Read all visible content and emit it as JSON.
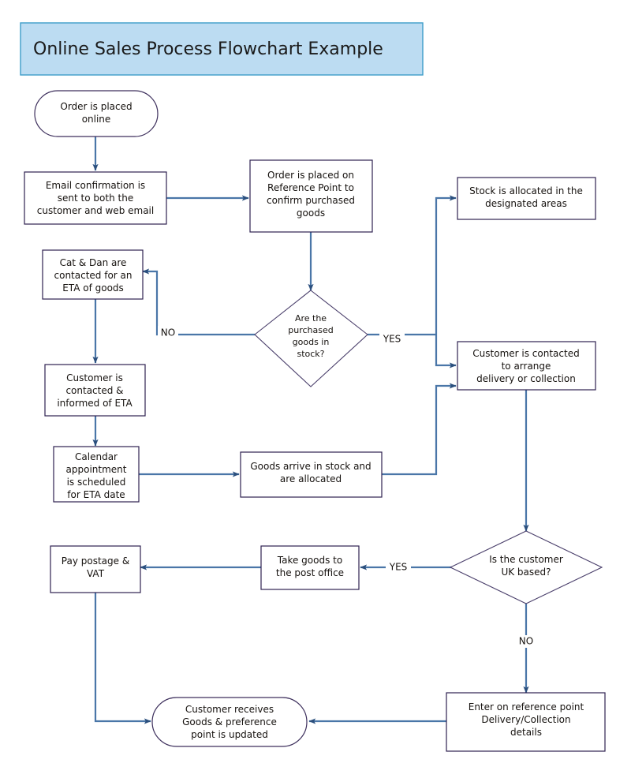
{
  "title": {
    "text": "Online Sales Process Flowchart Example",
    "fill_color": "#bcdcf2",
    "border_color": "#3d9cc9"
  },
  "colors": {
    "connector": "#4a76a8",
    "node_border": "#2e2150",
    "diamond_border": "#4a3f6b",
    "node_fill": "#ffffff",
    "text": "#16120f",
    "background": "#ffffff"
  },
  "chart_data": {
    "type": "diagram",
    "diagram_kind": "flowchart",
    "title": "Online Sales Process Flowchart Example",
    "nodes": [
      {
        "id": "start",
        "shape": "terminator",
        "lines": [
          "Order is placed",
          "online"
        ]
      },
      {
        "id": "email",
        "shape": "process",
        "lines": [
          "Email confirmation is",
          "sent to both the",
          "customer and web email"
        ]
      },
      {
        "id": "refpoint",
        "shape": "process",
        "lines": [
          "Order is placed on",
          "Reference Point to",
          "confirm purchased",
          "goods"
        ]
      },
      {
        "id": "instock",
        "shape": "decision",
        "lines": [
          "Are the",
          "purchased",
          "goods in",
          "stock?"
        ]
      },
      {
        "id": "stockalloc",
        "shape": "process",
        "lines": [
          "Stock is allocated in the",
          "designated areas"
        ]
      },
      {
        "id": "catdan",
        "shape": "process",
        "lines": [
          "Cat & Dan are",
          "contacted for an",
          "ETA of goods"
        ]
      },
      {
        "id": "custeta",
        "shape": "process",
        "lines": [
          "Customer is",
          "contacted &",
          "informed of ETA"
        ]
      },
      {
        "id": "calendar",
        "shape": "process",
        "lines": [
          "Calendar",
          "appointment",
          "is scheduled",
          "for ETA date"
        ]
      },
      {
        "id": "goodsarrive",
        "shape": "process",
        "lines": [
          "Goods arrive in stock and",
          "are allocated"
        ]
      },
      {
        "id": "custcontact",
        "shape": "process",
        "lines": [
          "Customer is contacted",
          "to arrange",
          "delivery or collection"
        ]
      },
      {
        "id": "ukbased",
        "shape": "decision",
        "lines": [
          "Is the customer",
          "UK based?"
        ]
      },
      {
        "id": "postoffice",
        "shape": "process",
        "lines": [
          "Take goods to",
          "the post office"
        ]
      },
      {
        "id": "postage",
        "shape": "process",
        "lines": [
          "Pay postage &",
          "VAT"
        ]
      },
      {
        "id": "enterref",
        "shape": "process",
        "lines": [
          "Enter on reference point",
          "Delivery/Collection",
          "details"
        ]
      },
      {
        "id": "end",
        "shape": "terminator",
        "lines": [
          "Customer receives",
          "Goods & preference",
          "point is updated"
        ]
      }
    ],
    "edges": [
      {
        "from": "start",
        "to": "email",
        "label": ""
      },
      {
        "from": "email",
        "to": "refpoint",
        "label": ""
      },
      {
        "from": "refpoint",
        "to": "instock",
        "label": ""
      },
      {
        "from": "instock",
        "to": "catdan",
        "label": "NO"
      },
      {
        "from": "instock",
        "to": "stockalloc",
        "label": "YES"
      },
      {
        "from": "instock",
        "to": "custcontact",
        "label": "YES"
      },
      {
        "from": "catdan",
        "to": "custeta",
        "label": ""
      },
      {
        "from": "custeta",
        "to": "calendar",
        "label": ""
      },
      {
        "from": "calendar",
        "to": "goodsarrive",
        "label": ""
      },
      {
        "from": "goodsarrive",
        "to": "custcontact",
        "label": ""
      },
      {
        "from": "custcontact",
        "to": "ukbased",
        "label": ""
      },
      {
        "from": "ukbased",
        "to": "postoffice",
        "label": "YES"
      },
      {
        "from": "postoffice",
        "to": "postage",
        "label": ""
      },
      {
        "from": "ukbased",
        "to": "enterref",
        "label": "NO"
      },
      {
        "from": "enterref",
        "to": "end",
        "label": ""
      },
      {
        "from": "postage",
        "to": "end",
        "label": ""
      }
    ],
    "edge_labels": [
      "NO",
      "YES",
      "YES",
      "NO"
    ]
  },
  "nodes": {
    "start": {
      "l1": "Order is placed",
      "l2": "online"
    },
    "email": {
      "l1": "Email confirmation is",
      "l2": "sent to both the",
      "l3": "customer and web email"
    },
    "refpoint": {
      "l1": "Order is placed on",
      "l2": "Reference Point to",
      "l3": "confirm purchased",
      "l4": "goods"
    },
    "instock": {
      "l1": "Are the",
      "l2": "purchased",
      "l3": "goods in",
      "l4": "stock?"
    },
    "stockalloc": {
      "l1": "Stock is allocated in the",
      "l2": "designated areas"
    },
    "catdan": {
      "l1": "Cat & Dan are",
      "l2": "contacted for an",
      "l3": "ETA of goods"
    },
    "custeta": {
      "l1": "Customer is",
      "l2": "contacted &",
      "l3": "informed of ETA"
    },
    "calendar": {
      "l1": "Calendar",
      "l2": "appointment",
      "l3": "is scheduled",
      "l4": "for ETA date"
    },
    "goodsarrive": {
      "l1": "Goods arrive in stock and",
      "l2": "are allocated"
    },
    "custcontact": {
      "l1": "Customer is contacted",
      "l2": "to arrange",
      "l3": "delivery or collection"
    },
    "ukbased": {
      "l1": "Is the customer",
      "l2": "UK based?"
    },
    "postoffice": {
      "l1": "Take goods to",
      "l2": "the post office"
    },
    "postage": {
      "l1": "Pay postage &",
      "l2": "VAT"
    },
    "enterref": {
      "l1": "Enter on reference point",
      "l2": "Delivery/Collection",
      "l3": "details"
    },
    "end": {
      "l1": "Customer receives",
      "l2": "Goods & preference",
      "l3": "point is updated"
    }
  },
  "labels": {
    "no_stock": "NO",
    "yes_stock": "YES",
    "yes_uk": "YES",
    "no_uk": "NO"
  }
}
